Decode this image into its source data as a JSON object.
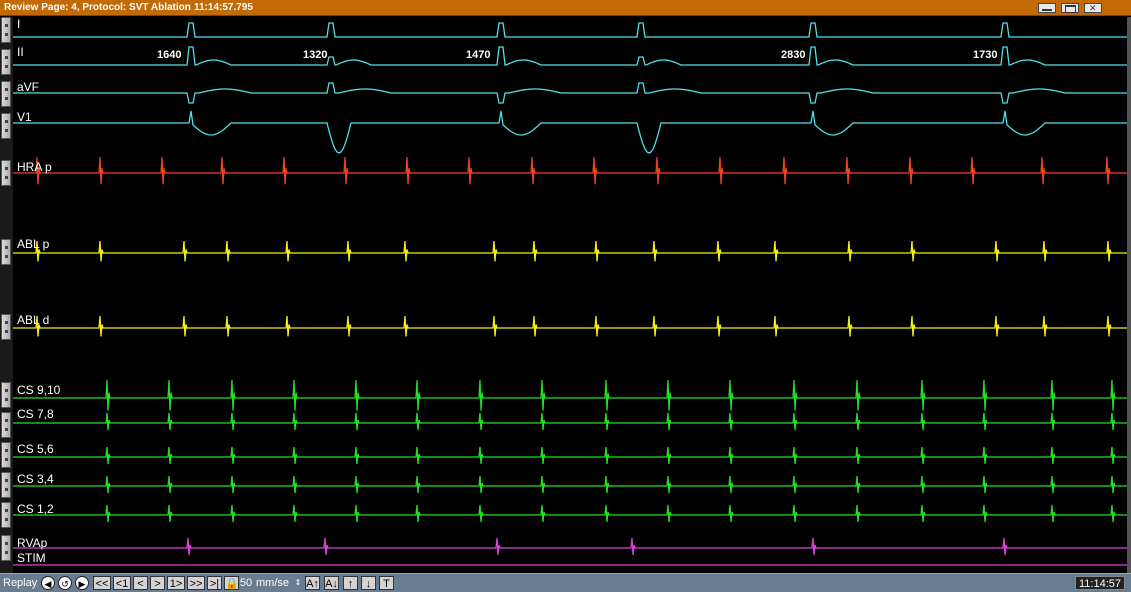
{
  "window": {
    "title": "Review Page: 4, Protocol:  SVT Ablation",
    "time": "11:14:57.795"
  },
  "channels": [
    {
      "label": "I",
      "color": "#4fe0e8"
    },
    {
      "label": "II",
      "color": "#4fe0e8"
    },
    {
      "label": "aVF",
      "color": "#4fe0e8"
    },
    {
      "label": "V1",
      "color": "#4fe0e8"
    },
    {
      "label": "HRA p",
      "color": "#f0441c"
    },
    {
      "label": "ABL p",
      "color": "#f5f010"
    },
    {
      "label": "ABL d",
      "color": "#f5f010"
    },
    {
      "label": "CS 9,10",
      "color": "#22e022"
    },
    {
      "label": "CS 7,8",
      "color": "#22e022"
    },
    {
      "label": "CS 5,6",
      "color": "#22e022"
    },
    {
      "label": "CS 3,4",
      "color": "#22e022"
    },
    {
      "label": "CS 1,2",
      "color": "#22e022"
    },
    {
      "label": "RVAp",
      "color": "#e040e0"
    },
    {
      "label": "STIM",
      "color": "#e040e0"
    }
  ],
  "intervals": [
    "1640",
    "1320",
    "1470",
    "2830",
    "1730"
  ],
  "toolbar": {
    "replay": "Replay",
    "first": "<<",
    "back1": "<1",
    "prev": "<",
    "next": ">",
    "fwd1": "1>",
    "last": ">>",
    "end": ">|",
    "speed_value": "50",
    "speed_unit": "mm/se",
    "text_button": "T",
    "clock": "11:14:57"
  }
}
